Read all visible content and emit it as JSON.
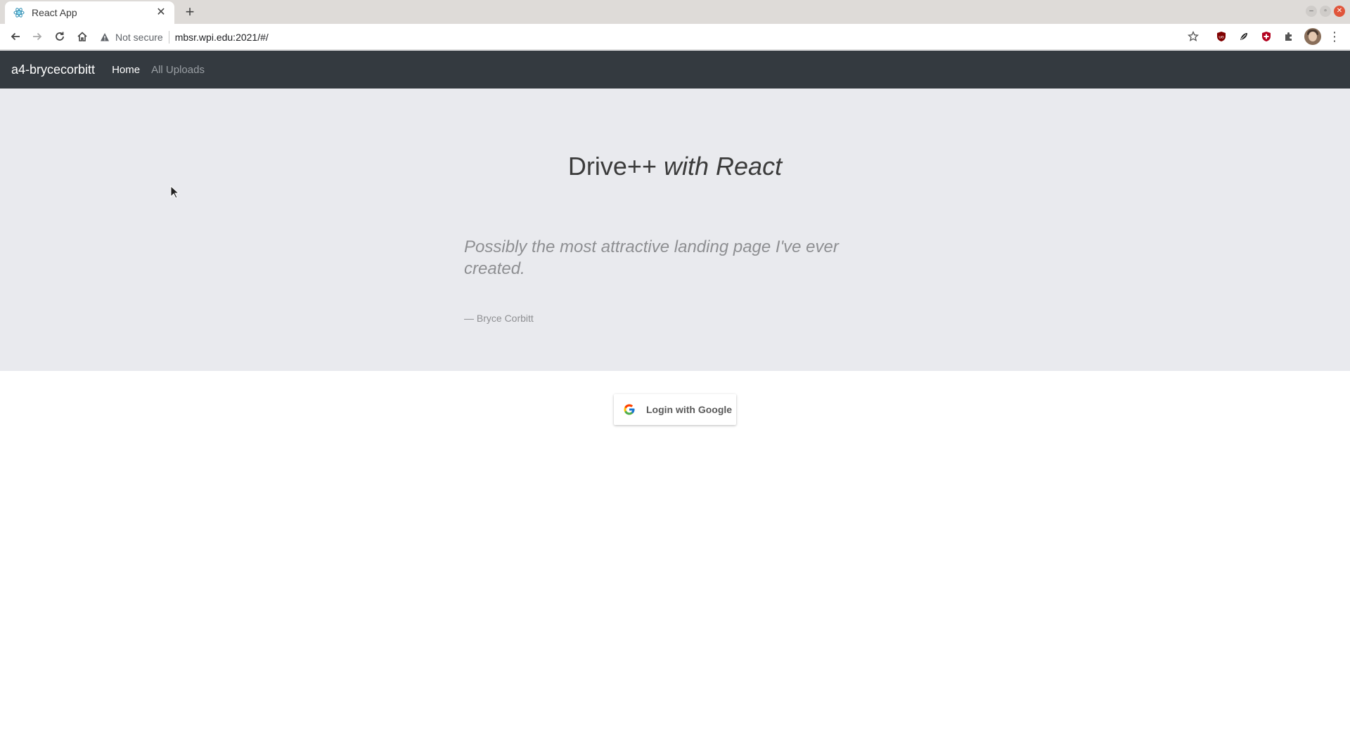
{
  "browser": {
    "tab": {
      "title": "React App",
      "favicon": "react-logo-icon",
      "close_glyph": "✕"
    },
    "new_tab_glyph": "+",
    "window_controls": {
      "minimize": "–",
      "maximize": "▫",
      "close": "✕"
    },
    "toolbar": {
      "security_label": "Not secure",
      "url": "mbsr.wpi.edu:2021/#/",
      "menu_glyph": "⋮"
    },
    "extensions": [
      "ublock-icon",
      "extension-leaf-icon",
      "shield-icon",
      "puzzle-icon"
    ]
  },
  "navbar": {
    "brand": "a4-brycecorbitt",
    "links": [
      {
        "label": "Home",
        "active": true
      },
      {
        "label": "All Uploads",
        "active": false
      }
    ],
    "background": "#343a40"
  },
  "hero": {
    "title_plain": "Drive++ ",
    "title_em": "with",
    "title_strong": "React",
    "quote": "Possibly the most attractive landing page I've ever created.",
    "author": "— Bryce Corbitt",
    "background": "#e9eaee"
  },
  "login": {
    "label": "Login with Google",
    "icon": "google-g-icon"
  }
}
